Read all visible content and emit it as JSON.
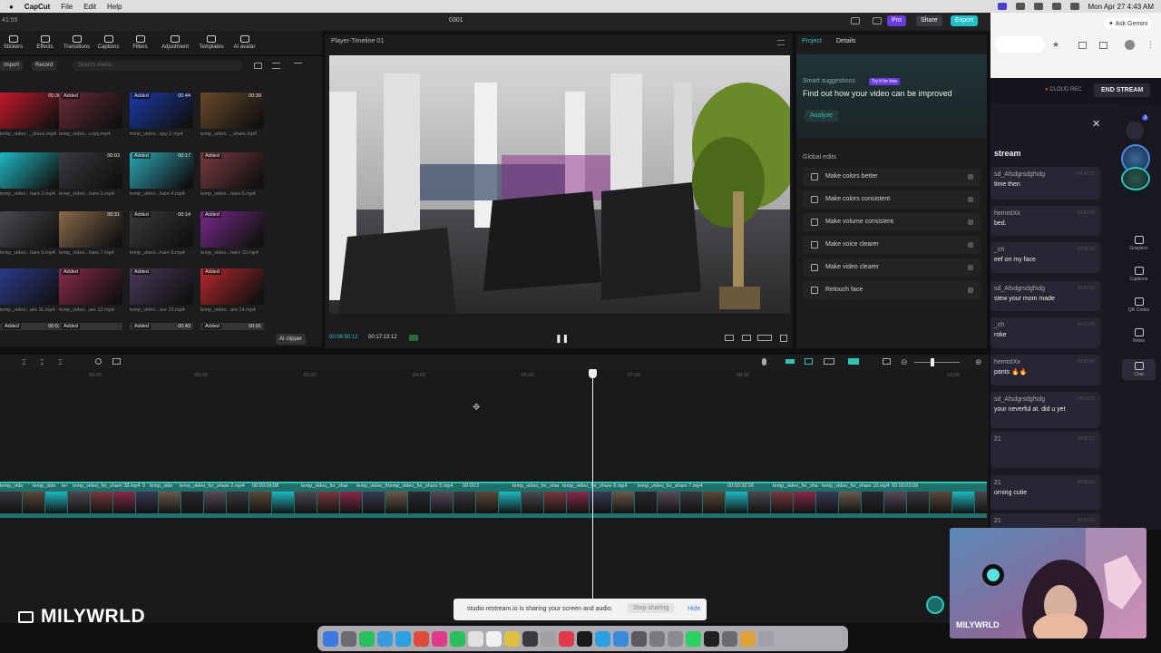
{
  "menubar": {
    "app_name": "CapCut",
    "items": [
      "File",
      "Edit",
      "Help"
    ],
    "datetime": "Mon Apr 27  4:43 AM"
  },
  "capcut": {
    "clock": "41:55",
    "window_title": "0301",
    "buttons": {
      "pro": "Pro",
      "share": "Share",
      "export": "Export"
    },
    "toolbar": [
      "Stickers",
      "Effects",
      "Transitions",
      "Captions",
      "Filters",
      "Adjustment",
      "Templates",
      "AI avatar"
    ],
    "media": {
      "import": "Import",
      "record": "Record",
      "search_placeholder": "Search media",
      "ai_clipper": "AI clipper",
      "thumbs": [
        {
          "tag": "",
          "dur": "00:30",
          "name": "temp_video..._share.mp4",
          "color": "#c01a2a"
        },
        {
          "tag": "Added",
          "dur": "",
          "name": "temp_video...copy.mp4",
          "color": "#6b2a36"
        },
        {
          "tag": "Added",
          "dur": "00:44",
          "name": "temp_video...opy 2.mp4",
          "color": "#1a3aa8"
        },
        {
          "tag": "",
          "dur": "00:39",
          "name": "temp_video..._share.mp4",
          "color": "#6a4a2a"
        },
        {
          "tag": "",
          "dur": "",
          "name": "temp_video...hare 2.mp4",
          "color": "#1fb8c4"
        },
        {
          "tag": "",
          "dur": "00:03",
          "name": "temp_video...hare 3.mp4",
          "color": "#3a3a40"
        },
        {
          "tag": "Added",
          "dur": "00:17",
          "name": "temp_video...hare 4.mp4",
          "color": "#2aa8b8"
        },
        {
          "tag": "Added",
          "dur": "",
          "name": "temp_video...hare 5.mp4",
          "color": "#7a3a3e"
        },
        {
          "tag": "",
          "dur": "",
          "name": "temp_video...hare 6.mp4",
          "color": "#4a4a50"
        },
        {
          "tag": "",
          "dur": "00:31",
          "name": "temp_video...hare 7.mp4",
          "color": "#8a6a4a"
        },
        {
          "tag": "Added",
          "dur": "00:14",
          "name": "temp_video...hare 8.mp4",
          "color": "#3a3a3e"
        },
        {
          "tag": "Added",
          "dur": "",
          "name": "temp_video...hare 10.mp4",
          "color": "#7a2a8a"
        },
        {
          "tag": "",
          "dur": "",
          "name": "temp_video...are 11.mp4",
          "color": "#2a3a8a"
        },
        {
          "tag": "Added",
          "dur": "",
          "name": "temp_video...are 12.mp4",
          "color": "#8a2a4a"
        },
        {
          "tag": "Added",
          "dur": "",
          "name": "temp_video...are 13.mp4",
          "color": "#4a3a5a"
        },
        {
          "tag": "Added",
          "dur": "",
          "name": "temp_video...are 14.mp4",
          "color": "#b8282e"
        }
      ],
      "partial_row": [
        {
          "tag": "Added",
          "dur": "00:52"
        },
        {
          "tag": "Added",
          "dur": ""
        },
        {
          "tag": "Added",
          "dur": "00:43"
        },
        {
          "tag": "Added",
          "dur": "00:01"
        }
      ]
    },
    "player": {
      "title": "Player-Timeline 01",
      "current_time": "00:06:50:12",
      "total_time": "00:17:13:12"
    },
    "right_panel": {
      "tabs": [
        "Project",
        "Details"
      ],
      "smart_label": "Smart suggestions",
      "smart_badge": "Try it for free",
      "headline": "Find out how your video can be improved",
      "analyze": "Analyze",
      "global_title": "Global edits",
      "edits": [
        "Make colors better",
        "Make colors consistent",
        "Make volume consistent",
        "Make voice clearer",
        "Make video clearer",
        "Retouch face"
      ]
    },
    "timeline": {
      "ruler": [
        "00:00",
        "00:00",
        "00:30",
        "04:00",
        "05:30",
        "07:00",
        "08:30",
        "10:00"
      ],
      "clip_labels": [
        "temp_vide",
        "temp_vide",
        "ter",
        "temp_video_for_share 38.mp4",
        "0",
        "temp_vide",
        "temp_video_for_share 2.mp4",
        "00:00:34:08",
        "temp_video_for_shar",
        "temp_video_fi",
        "temp_video_for_share 5.mp4",
        "00:00:2",
        "temp_video_for_shar",
        "temp_video_for_share 6.mp4",
        "temp_video_for_share 7.mp4",
        "00:00:30:26",
        "temp_video_for_sha",
        "temp_video_for_share 10.mp4",
        "00:00:03:09"
      ]
    }
  },
  "sharing": {
    "message": "studio.restream.io is sharing your screen and audio.",
    "stop": "Stop sharing",
    "hide": "Hide"
  },
  "brand": {
    "name": "MILYWRLD"
  },
  "browser": {
    "ask_gemini": "Ask Gemini"
  },
  "restream": {
    "cloud_rec": "CLOUD REC",
    "end_stream": "END STREAM",
    "chat_title": "stream",
    "messages": [
      {
        "user": "sd_Afsdgrsdgfsdg",
        "text": "time then",
        "time": "04:40:52"
      },
      {
        "user": "hemistXx",
        "text": "bed.",
        "time": "04:02:08"
      },
      {
        "user": "_ch",
        "text": "eef on my face",
        "time": "04:05:04"
      },
      {
        "user": "sd_Afsdgrsdgfsdg",
        "text": "stew your mom made",
        "time": "04:10:52"
      },
      {
        "user": "_ch",
        "text": "roke",
        "time": "04:12:08"
      },
      {
        "user": "hemistXx",
        "text": "pants 🔥🔥",
        "time": "04:20:00"
      },
      {
        "user": "sd_Afsdgrsdgfsdg",
        "text": "your neverful at. did u yet",
        "time": "04:19:35"
      },
      {
        "user": "21",
        "text": "",
        "time": "04:20:13"
      },
      {
        "user": "21",
        "text": "orning cutie",
        "time": "04:20:00"
      },
      {
        "user": "21",
        "text": "",
        "time": "04:22:03"
      }
    ],
    "side_items": [
      "Graphics",
      "Captions",
      "QR Codes",
      "Notes",
      "Chat"
    ],
    "notification_count": "3",
    "webcam_name": "MILYWRLD"
  },
  "colors": {
    "accent": "#2ec4b6",
    "pro": "#6a3ce0",
    "export": "#1fc0c8",
    "track": "#1f6f6a"
  }
}
